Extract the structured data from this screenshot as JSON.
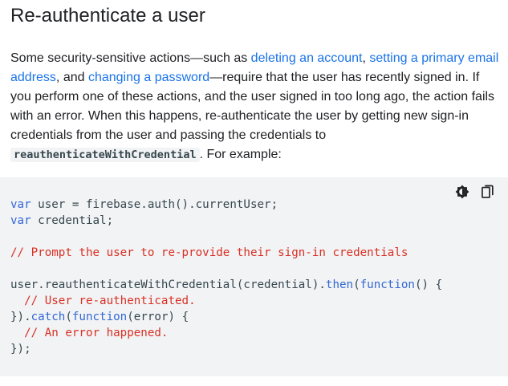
{
  "page": {
    "title": "Re-authenticate a user"
  },
  "intro": {
    "t1": "Some security-sensitive actions—such as ",
    "link_delete": "deleting an account",
    "t2": ", ",
    "link_email": "setting a primary email address",
    "t3": ", and ",
    "link_password": "changing a password",
    "t4": "—require that the user has recently signed in. If you perform one of these actions, and the user signed in too long ago, the action fails with an error. When this happens, re-authenticate the user by getting new sign-in credentials from the user and passing the credentials to ",
    "inline_code": "reauthenticateWithCredential",
    "t5": ". For example:"
  },
  "code_tools": {
    "theme_icon": "dark-mode-toggle-icon",
    "copy_icon": "copy-icon"
  },
  "code": {
    "l1_kw": "var",
    "l1_rest": " user = firebase.auth().currentUser;",
    "l2_kw": "var",
    "l2_rest": " credential;",
    "l4_comment": "// Prompt the user to re-provide their sign-in credentials",
    "l6_a": "user.reauthenticateWithCredential(credential).",
    "l6_then": "then",
    "l6_b": "(",
    "l6_fn": "function",
    "l6_c": "() {",
    "l7_comment": "  // User re-authenticated.",
    "l8_a": "}).",
    "l8_catch": "catch",
    "l8_b": "(",
    "l8_fn": "function",
    "l8_c": "(error) {",
    "l9_comment": "  // An error happened.",
    "l10": "});"
  },
  "colors": {
    "link": "#1a73e8",
    "keyword": "#3367d6",
    "comment": "#d93025",
    "code_bg": "#f1f3f4"
  }
}
